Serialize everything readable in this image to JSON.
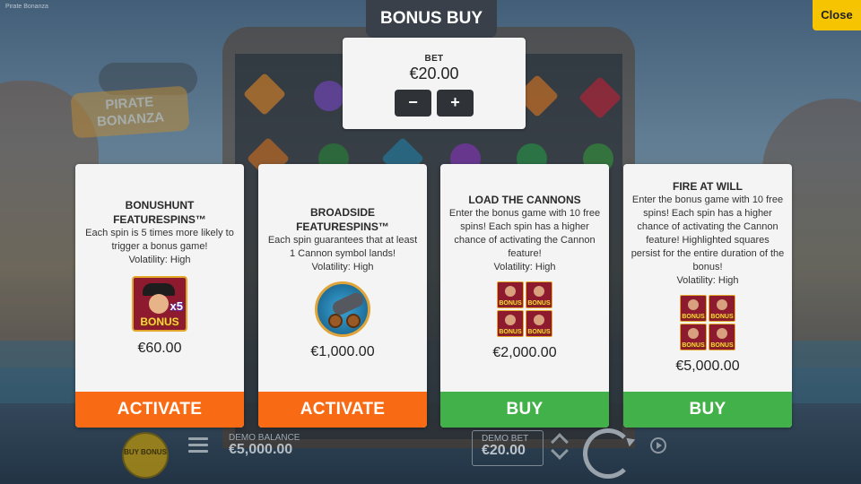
{
  "window": {
    "top_text": "Pirate Bonanza"
  },
  "header": {
    "title": "BONUS BUY",
    "close_label": "Close"
  },
  "bet": {
    "label": "BET",
    "value": "€20.00",
    "decrease_label": "−",
    "increase_label": "+"
  },
  "scene": {
    "logo_text": "PIRATE BONANZA"
  },
  "cards": [
    {
      "title": "BONUSHUNT FEATURESPINS™",
      "description": "Each spin is 5 times more likely to trigger a bonus game!",
      "volatility": "Volatility: High",
      "symbol_icon": "pirate-x5-bonus-icon",
      "symbol_multiplier": "x5",
      "symbol_text": "BONUS",
      "price": "€60.00",
      "action": "ACTIVATE",
      "action_color": "#f86a14"
    },
    {
      "title": "BROADSIDE FEATURESPINS™",
      "description": "Each spin guarantees that at least 1 Cannon symbol lands!",
      "volatility": "Volatility: High",
      "symbol_icon": "cannon-icon",
      "price": "€1,000.00",
      "action": "ACTIVATE",
      "action_color": "#f86a14"
    },
    {
      "title": "LOAD THE CANNONS",
      "description": "Enter the bonus game with 10 free spins! Each spin has a higher chance of activating the Cannon feature!",
      "volatility": "Volatility: High",
      "symbol_icon": "bonus-grid-icon",
      "symbol_text": "BONUS",
      "price": "€2,000.00",
      "action": "BUY",
      "action_color": "#43b14a"
    },
    {
      "title": "FIRE AT WILL",
      "description": "Enter the bonus game with 10 free spins! Each spin has a higher chance of activating the Cannon feature! Highlighted squares persist for the entire duration of the bonus!",
      "volatility": "Volatility: High",
      "symbol_icon": "bonus-grid-icon",
      "symbol_text": "BONUS",
      "price": "€5,000.00",
      "action": "BUY",
      "action_color": "#43b14a"
    }
  ],
  "bottom_bar": {
    "buy_bonus_label": "BUY BONUS",
    "demo_balance_label": "DEMO BALANCE",
    "demo_balance_value": "€5,000.00",
    "demo_bet_label": "DEMO BET",
    "demo_bet_value": "€20.00"
  }
}
